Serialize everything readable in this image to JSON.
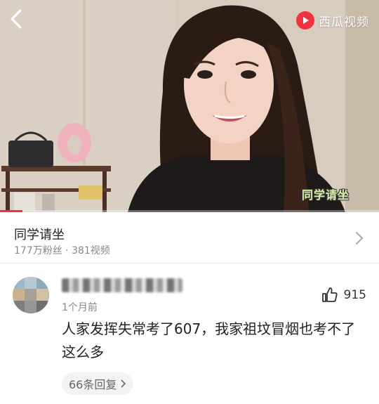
{
  "video": {
    "brand_name": "西瓜视频",
    "watermark": "同学请坐",
    "progress": 0.06,
    "accent_color": "#f0343f"
  },
  "channel": {
    "name": "同学请坐",
    "stats": "177万粉丝 · 381视频"
  },
  "comment": {
    "time": "1个月前",
    "like_count": "915",
    "text": "人家发挥失常考了607，我家祖坟冒烟也考不了这么多",
    "replies_label": "66条回复"
  },
  "icons": {
    "back": "back-arrow-icon",
    "brand": "xigua-logo-icon",
    "chevron": "chevron-right-icon",
    "like": "thumbs-up-icon"
  }
}
